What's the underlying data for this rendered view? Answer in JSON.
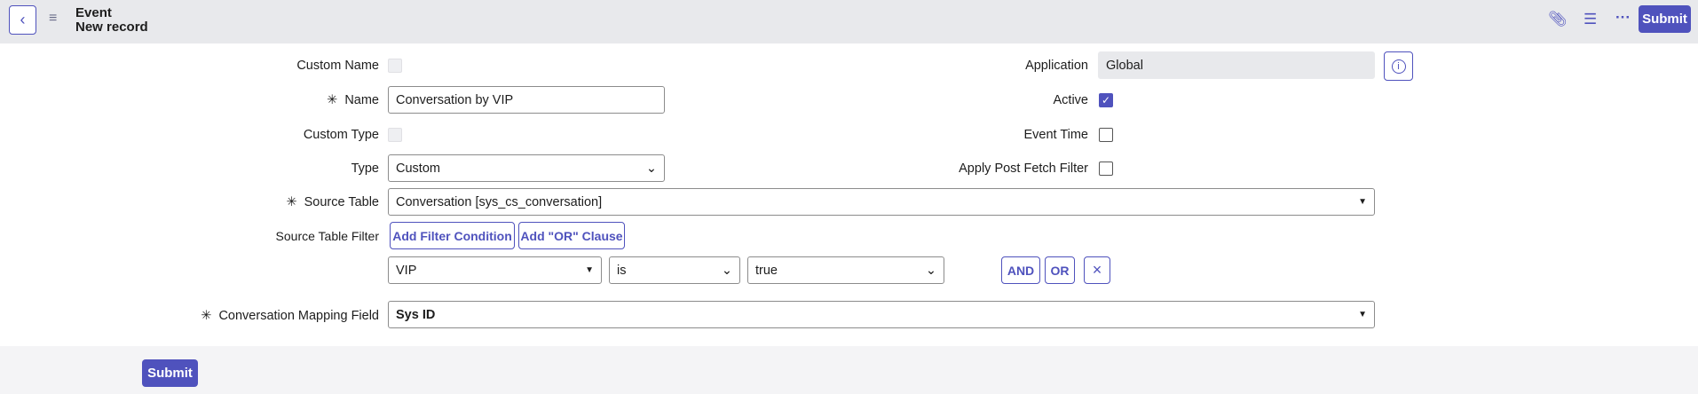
{
  "header": {
    "title": "Event",
    "subtitle": "New record",
    "submit_label": "Submit",
    "more_label": "···"
  },
  "form": {
    "custom_name": {
      "label": "Custom Name",
      "checked": false
    },
    "name": {
      "label": "Name",
      "value": "Conversation by VIP",
      "required": "✳"
    },
    "custom_type": {
      "label": "Custom Type",
      "checked": false
    },
    "type": {
      "label": "Type",
      "value": "Custom"
    },
    "source_table": {
      "label": "Source Table",
      "value": "Conversation [sys_cs_conversation]",
      "required": "✳"
    },
    "source_table_filter": {
      "label": "Source Table Filter",
      "add_condition": "Add Filter Condition",
      "add_or": "Add \"OR\" Clause",
      "condition": {
        "field": "VIP",
        "operator": "is",
        "value": "true"
      },
      "and_label": "AND",
      "or_label": "OR",
      "remove_label": "×"
    },
    "mapping": {
      "label": "Conversation Mapping Field",
      "value": "Sys ID",
      "required": "✳"
    },
    "application": {
      "label": "Application",
      "value": "Global",
      "info": "i"
    },
    "active": {
      "label": "Active",
      "checked": true
    },
    "event_time": {
      "label": "Event Time",
      "checked": false
    },
    "apply_post_fetch": {
      "label": "Apply Post Fetch Filter",
      "checked": false
    }
  },
  "footer": {
    "submit_label": "Submit"
  },
  "colors": {
    "accent": "#4f52bd",
    "header_bg": "#e8e9ec"
  }
}
